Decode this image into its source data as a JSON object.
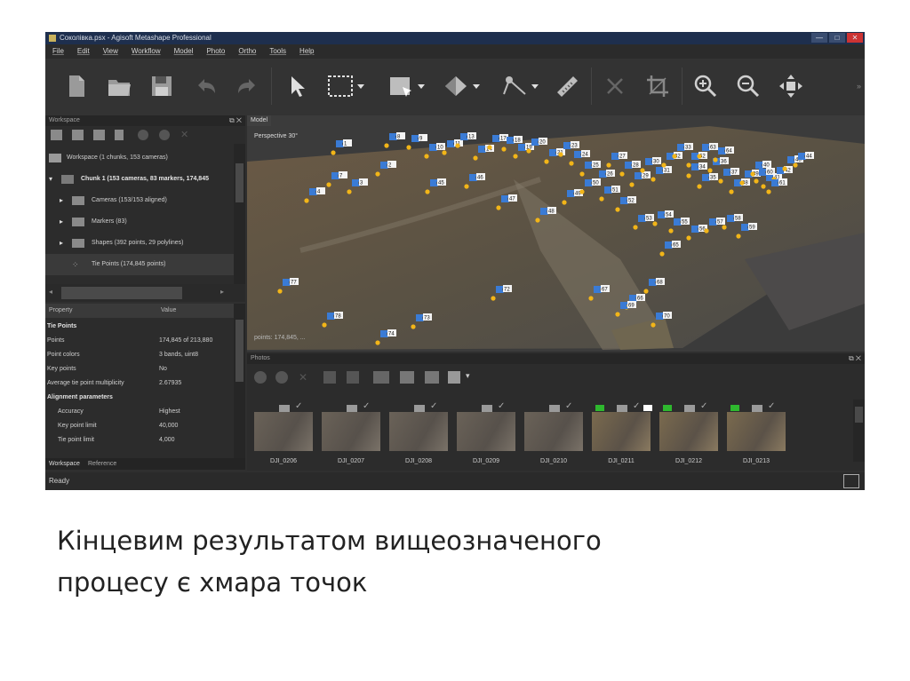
{
  "window": {
    "title": "Соколівка.psx - Agisoft Metashape Professional",
    "controls": [
      "—",
      "□",
      "✕"
    ]
  },
  "menu": [
    "File",
    "Edit",
    "View",
    "Workflow",
    "Model",
    "Photo",
    "Ortho",
    "Tools",
    "Help"
  ],
  "toolbar_icons": [
    "new-document-icon",
    "open-folder-icon",
    "save-icon",
    "undo-icon",
    "redo-icon",
    "pointer-icon",
    "rectangle-select-icon",
    "draw-shape-icon",
    "navigation-icon",
    "ruler-point-icon",
    "ruler-icon",
    "close-icon",
    "crop-icon",
    "zoom-in-icon",
    "zoom-out-icon",
    "reset-view-icon"
  ],
  "workspace": {
    "header": "Workspace",
    "tree": [
      {
        "label": "Workspace (1 chunks, 153 cameras)",
        "bold": false
      },
      {
        "label": "Chunk 1 (153 cameras, 83 markers, 174,845",
        "bold": true
      },
      {
        "label": "Cameras (153/153 aligned)",
        "bold": false
      },
      {
        "label": "Markers (83)",
        "bold": false
      },
      {
        "label": "Shapes (392 points, 29 polylines)",
        "bold": false
      },
      {
        "label": "Tie Points (174,845 points)",
        "bold": false
      }
    ]
  },
  "properties": {
    "col_property": "Property",
    "col_value": "Value",
    "rows": [
      {
        "k": "Tie Points",
        "v": "",
        "type": "group"
      },
      {
        "k": "Points",
        "v": "174,845 of 213,880",
        "type": "item"
      },
      {
        "k": "Point colors",
        "v": "3 bands, uint8",
        "type": "item"
      },
      {
        "k": "Key points",
        "v": "No",
        "type": "item"
      },
      {
        "k": "Average tie point multiplicity",
        "v": "2.67935",
        "type": "item"
      },
      {
        "k": "Alignment parameters",
        "v": "",
        "type": "group"
      },
      {
        "k": "Accuracy",
        "v": "Highest",
        "type": "indent"
      },
      {
        "k": "Key point limit",
        "v": "40,000",
        "type": "indent"
      },
      {
        "k": "Tie point limit",
        "v": "4,000",
        "type": "indent"
      }
    ]
  },
  "bottom_tabs": [
    "Workspace",
    "Reference"
  ],
  "status": "Ready",
  "model": {
    "tab": "Model",
    "perspective": "Perspective 30°",
    "points_readout": "points: 174,845, ...",
    "markers": [
      "1",
      "2",
      "3",
      "4",
      "7",
      "8",
      "9",
      "10",
      "11",
      "13",
      "14",
      "17",
      "18",
      "19",
      "20",
      "21",
      "23",
      "24",
      "25",
      "26",
      "27",
      "28",
      "29",
      "30",
      "31",
      "32",
      "33",
      "34",
      "35",
      "36",
      "37",
      "38",
      "39",
      "40",
      "41",
      "42",
      "43",
      "44",
      "45",
      "46",
      "47",
      "48",
      "49",
      "50",
      "51",
      "52",
      "53",
      "54",
      "55",
      "56",
      "57",
      "58",
      "59",
      "60",
      "61",
      "62",
      "63",
      "64",
      "65",
      "66",
      "67",
      "68",
      "69",
      "70",
      "72",
      "73",
      "74",
      "77",
      "78"
    ]
  },
  "photos": {
    "header": "Photos",
    "items": [
      {
        "name": "DJI_0206",
        "flag": "none"
      },
      {
        "name": "DJI_0207",
        "flag": "none"
      },
      {
        "name": "DJI_0208",
        "flag": "none"
      },
      {
        "name": "DJI_0209",
        "flag": "none"
      },
      {
        "name": "DJI_0210",
        "flag": "none"
      },
      {
        "name": "DJI_0211",
        "flag": "green-white"
      },
      {
        "name": "DJI_0212",
        "flag": "green"
      },
      {
        "name": "DJI_0213",
        "flag": "green"
      }
    ]
  },
  "caption": {
    "line1": "Кінцевим результатом вищеозначеного",
    "line2": "процесу є хмара точок"
  }
}
